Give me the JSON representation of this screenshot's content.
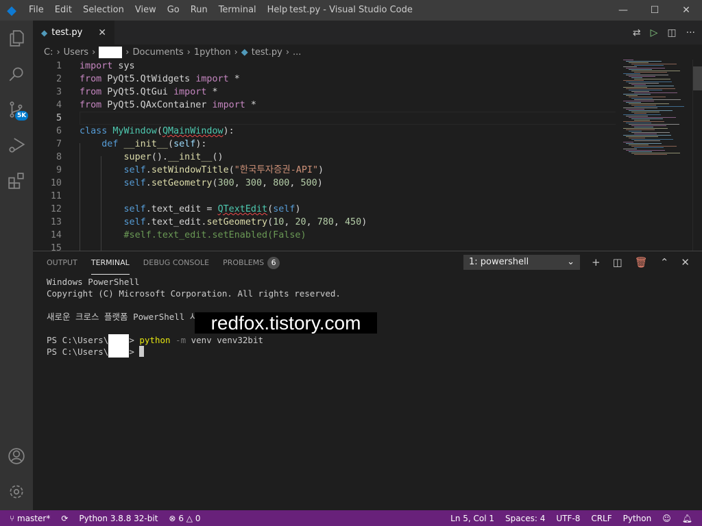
{
  "window": {
    "title": "test.py - Visual Studio Code",
    "menu": [
      "File",
      "Edit",
      "Selection",
      "View",
      "Go",
      "Run",
      "Terminal",
      "Help"
    ]
  },
  "activity": {
    "scm_badge": "5K"
  },
  "tab": {
    "label": "test.py"
  },
  "breadcrumb": [
    "C:",
    "Users",
    "Documents",
    "1python",
    "test.py",
    "..."
  ],
  "code": [
    [
      [
        "kw",
        "import"
      ],
      [
        "pl",
        " sys"
      ]
    ],
    [
      [
        "kw",
        "from"
      ],
      [
        "pl",
        " PyQt5.QtWidgets "
      ],
      [
        "kw",
        "import"
      ],
      [
        "pl",
        " *"
      ]
    ],
    [
      [
        "kw",
        "from"
      ],
      [
        "pl",
        " PyQt5.QtGui "
      ],
      [
        "kw",
        "import"
      ],
      [
        "pl",
        " *"
      ]
    ],
    [
      [
        "kw",
        "from"
      ],
      [
        "pl",
        " PyQt5.QAxContainer "
      ],
      [
        "kw",
        "import"
      ],
      [
        "pl",
        " *"
      ]
    ],
    [],
    [
      [
        "bl",
        "class"
      ],
      [
        "pl",
        " "
      ],
      [
        "cls",
        "MyWindow"
      ],
      [
        "pl",
        "("
      ],
      [
        "cls sq",
        "QMainWindow"
      ],
      [
        "pl",
        "):"
      ]
    ],
    [
      [
        "pl",
        "    "
      ],
      [
        "bl",
        "def"
      ],
      [
        "pl",
        " "
      ],
      [
        "fn",
        "__init__"
      ],
      [
        "pl",
        "("
      ],
      [
        "var",
        "self"
      ],
      [
        "pl",
        "):"
      ]
    ],
    [
      [
        "pl",
        "        "
      ],
      [
        "fn",
        "super"
      ],
      [
        "pl",
        "()."
      ],
      [
        "fn",
        "__init__"
      ],
      [
        "pl",
        "()"
      ]
    ],
    [
      [
        "pl",
        "        "
      ],
      [
        "bl",
        "self"
      ],
      [
        "pl",
        "."
      ],
      [
        "fn",
        "setWindowTitle"
      ],
      [
        "pl",
        "("
      ],
      [
        "str",
        "\"한국투자증권-API\""
      ],
      [
        "pl",
        ")"
      ]
    ],
    [
      [
        "pl",
        "        "
      ],
      [
        "bl",
        "self"
      ],
      [
        "pl",
        "."
      ],
      [
        "fn",
        "setGeometry"
      ],
      [
        "pl",
        "("
      ],
      [
        "num",
        "300"
      ],
      [
        "pl",
        ", "
      ],
      [
        "num",
        "300"
      ],
      [
        "pl",
        ", "
      ],
      [
        "num",
        "800"
      ],
      [
        "pl",
        ", "
      ],
      [
        "num",
        "500"
      ],
      [
        "pl",
        ")"
      ]
    ],
    [],
    [
      [
        "pl",
        "        "
      ],
      [
        "bl",
        "self"
      ],
      [
        "pl",
        ".text_edit = "
      ],
      [
        "cls sq",
        "QTextEdit"
      ],
      [
        "pl",
        "("
      ],
      [
        "bl",
        "self"
      ],
      [
        "pl",
        ")"
      ]
    ],
    [
      [
        "pl",
        "        "
      ],
      [
        "bl",
        "self"
      ],
      [
        "pl",
        ".text_edit."
      ],
      [
        "fn",
        "setGeometry"
      ],
      [
        "pl",
        "("
      ],
      [
        "num",
        "10"
      ],
      [
        "pl",
        ", "
      ],
      [
        "num",
        "20"
      ],
      [
        "pl",
        ", "
      ],
      [
        "num",
        "780"
      ],
      [
        "pl",
        ", "
      ],
      [
        "num",
        "450"
      ],
      [
        "pl",
        ")"
      ]
    ],
    [
      [
        "pl",
        "        "
      ],
      [
        "cm",
        "#self.text_edit.setEnabled(False)"
      ]
    ],
    []
  ],
  "panel": {
    "tabs": [
      "OUTPUT",
      "TERMINAL",
      "DEBUG CONSOLE",
      "PROBLEMS"
    ],
    "problems_count": "6",
    "terminal_select": "1: powershell"
  },
  "terminal": {
    "line1": "Windows PowerShell",
    "line2": "Copyright (C) Microsoft Corporation. All rights reserved.",
    "line3": "새로운 크로스 플랫폼 PowerShell 사용 https://aka.ms/pscore6",
    "prompt": "PS C:\\Users\\",
    "gt": ">",
    "cmd": "python",
    "flag": " -m",
    "args": " venv venv32bit"
  },
  "watermark": "redfox.tistory.com",
  "status": {
    "branch": "master*",
    "interpreter": "Python 3.8.8 32-bit",
    "errors": "6",
    "warnings": "0",
    "position": "Ln 5, Col 1",
    "spaces": "Spaces: 4",
    "encoding": "UTF-8",
    "eol": "CRLF",
    "language": "Python"
  },
  "colors": {
    "status_bar": "#68217a",
    "accent": "#007acc"
  }
}
